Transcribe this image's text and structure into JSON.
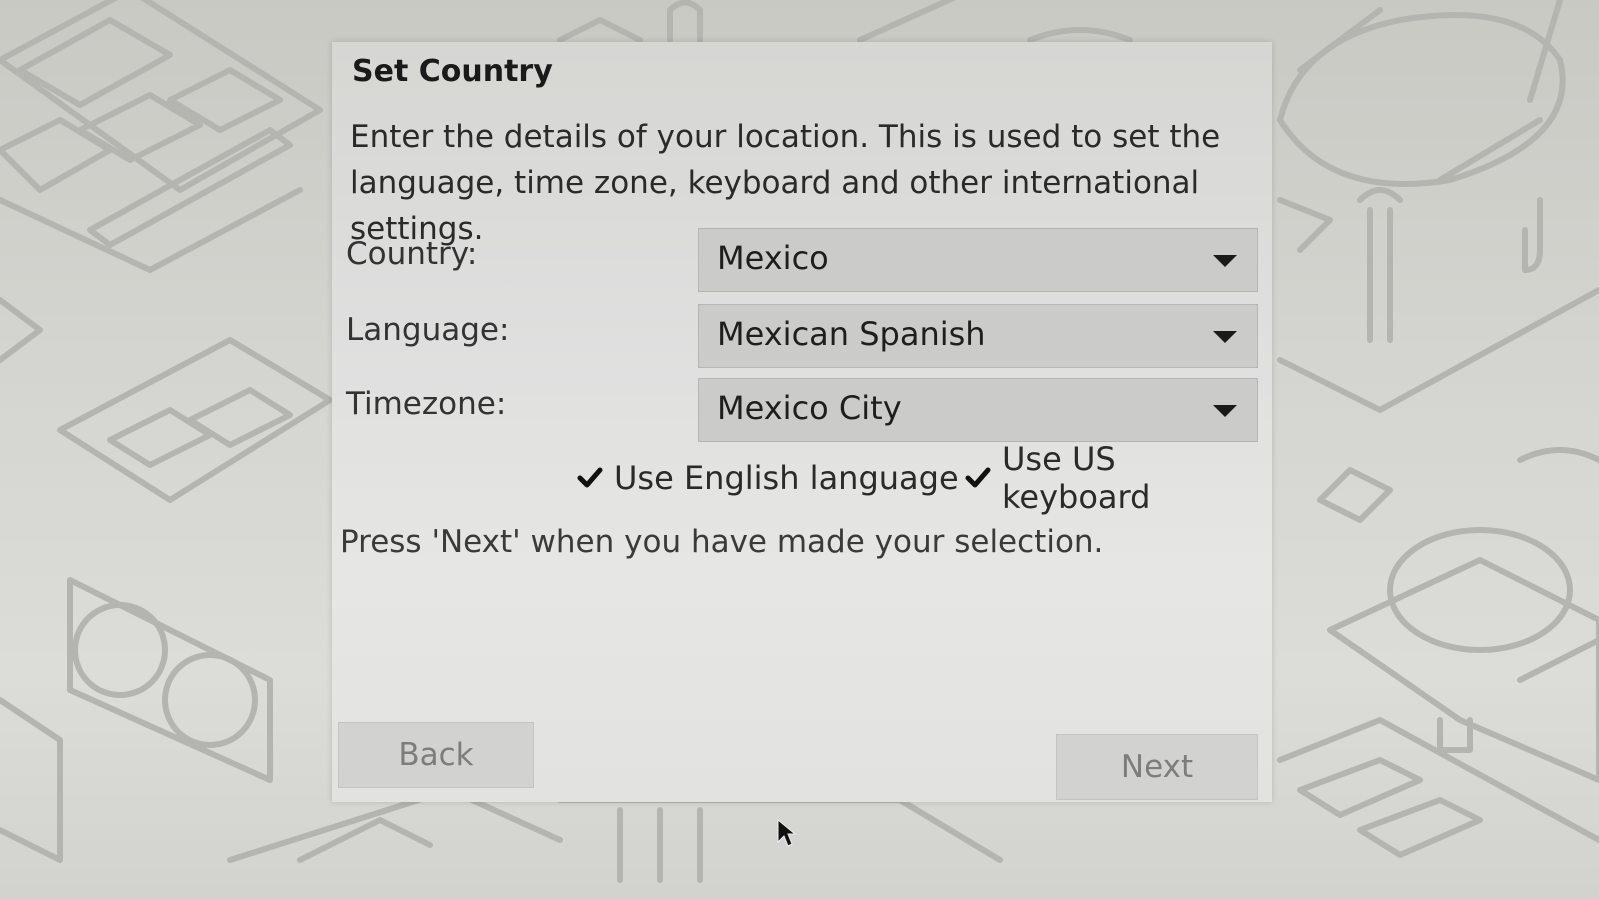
{
  "dialog": {
    "title": "Set Country",
    "description": "Enter the details of your location. This is used to set the language, time zone, keyboard and other international settings."
  },
  "fields": {
    "country": {
      "label": "Country:",
      "value": "Mexico"
    },
    "language": {
      "label": "Language:",
      "value": "Mexican Spanish"
    },
    "timezone": {
      "label": "Timezone:",
      "value": "Mexico City"
    }
  },
  "options": {
    "english": {
      "label": "Use English language",
      "checked": true
    },
    "us_keyboard": {
      "label": "Use US keyboard",
      "checked": true
    }
  },
  "hint": "Press 'Next' when you have made your selection.",
  "buttons": {
    "back": "Back",
    "next": "Next"
  },
  "icons": {
    "dropdown": "chevron-down-icon",
    "check": "checkmark-icon",
    "cursor": "mouse-pointer-icon"
  },
  "colors": {
    "wallpaper_line": "#b4b4b0",
    "dialog_bg": "#dedede",
    "combo_bg": "#cbcbc9",
    "button_text": "#7d7d7d"
  }
}
